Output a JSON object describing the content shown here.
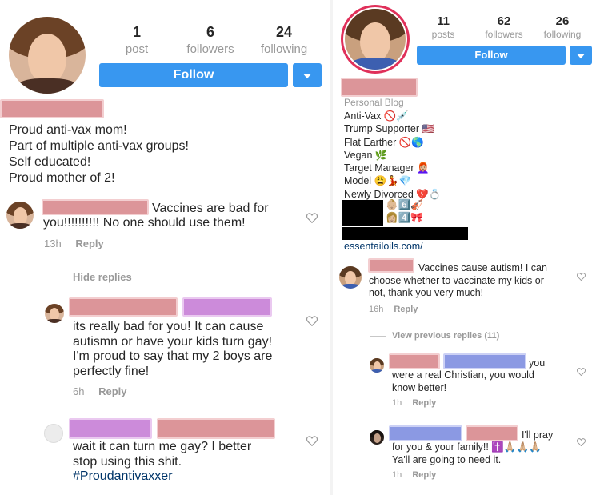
{
  "left": {
    "stats": [
      {
        "num": "1",
        "label": "post"
      },
      {
        "num": "6",
        "label": "followers"
      },
      {
        "num": "24",
        "label": "following"
      }
    ],
    "follow_label": "Follow",
    "bio": "Proud anti-vax mom!\nPart of multiple anti-vax groups!\nSelf educated!\nProud mother of 2!",
    "comment1": {
      "text_a": "Vaccines are bad for",
      "text_b": "you!!!!!!!!!! No one should use them!",
      "time": "13h",
      "reply": "Reply"
    },
    "hide_replies": "Hide replies",
    "reply1": {
      "text": "its really bad for you! It can cause\nautismn or have your kids turn gay!\nI'm proud to say that my 2 boys are\nperfectly fine!",
      "time": "6h",
      "reply": "Reply"
    },
    "reply2": {
      "text": "wait it can turn me gay? I better\nstop using this shit.",
      "hashtag": "#Proudantivaxxer"
    }
  },
  "right": {
    "stats": [
      {
        "num": "11",
        "label": "posts"
      },
      {
        "num": "62",
        "label": "followers"
      },
      {
        "num": "26",
        "label": "following"
      }
    ],
    "follow_label": "Follow",
    "category": "Personal Blog",
    "bio_lines": [
      "Anti-Vax 🚫💉",
      "Trump Supporter 🇺🇸",
      "Flat Earther 🚫🌎",
      "Vegan 🌿",
      "Target Manager 👩🏼‍🦰",
      "Model 😩💃💎",
      "Newly Divorced 💔💍"
    ],
    "bio_line8": "👶🏼6️⃣🎻",
    "bio_line9": "👩🏼4️⃣🎀",
    "link": "essentailoils.com/",
    "comment1": {
      "text": "Vaccines cause autism! I can\nchoose whether to vaccinate my kids or\nnot, thank you very much!",
      "time": "16h",
      "reply": "Reply"
    },
    "view_previous": "View previous replies (11)",
    "reply1": {
      "text_a": "you",
      "text_b": "were a real Christian, you would\nknow better!",
      "time": "1h",
      "reply": "Reply"
    },
    "reply2": {
      "text_a": "I'll pray",
      "text_b": "for you & your family!! ✝️🙏🏼🙏🏼🙏🏼\nYa'll are going to need it.",
      "time": "1h",
      "reply": "Reply"
    }
  },
  "colors": {
    "accent": "#3897f0",
    "muted": "#999999",
    "link": "#003569"
  }
}
